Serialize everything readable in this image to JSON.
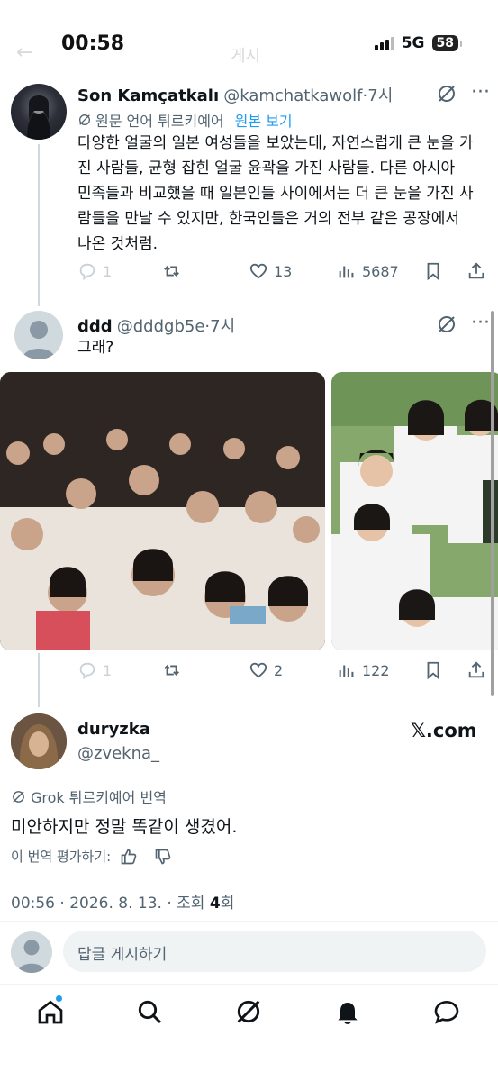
{
  "status_bar": {
    "time": "00:58",
    "network": "5G",
    "battery": "58"
  },
  "faded_header": {
    "title": "게시"
  },
  "tweet1": {
    "name": "Son Kamçatkalı",
    "handle": "@kamchatkawolf",
    "time": "·7시",
    "translation_note": "원문 언어 튀르키예어",
    "show_original": "원본 보기",
    "text": "다양한 얼굴의 일본 여성들을 보았는데, 자연스럽게 큰 눈을 가진 사람들, 균형 잡힌 얼굴 윤곽을 가진 사람들. 다른 아시아 민족들과 비교했을 때 일본인들 사이에서는 더 큰 눈을 가진 사람들을 만날 수 있지만, 한국인들은 거의 전부 같은 공장에서 나온 것처럼.",
    "replies": "1",
    "likes": "13",
    "views": "5687"
  },
  "tweet2": {
    "name": "ddd",
    "handle": "@dddgb5e",
    "time": "·7시",
    "text": "그래?",
    "replies": "1",
    "likes": "2",
    "views": "122"
  },
  "quoted_card": {
    "name": "duryzka",
    "handle": "@zvekna_",
    "source": "𝕏.com",
    "translation_label": "Grok 튀르키예어 번역",
    "text": "미안하지만 정말 똑같이 생겼어.",
    "rate_label": "이 번역 평가하기:",
    "meta_prefix": "00:56 · 2026. 8. 13. · 조회 ",
    "meta_count": "4",
    "meta_suffix": "회"
  },
  "reply_box": {
    "placeholder": "답글 게시하기"
  },
  "colors": {
    "accent": "#1d9bf0",
    "muted": "#536471",
    "border": "#eff3f4"
  },
  "nav": {
    "items": [
      "home-icon",
      "search-icon",
      "grok-icon",
      "notifications-icon",
      "messages-icon"
    ]
  }
}
